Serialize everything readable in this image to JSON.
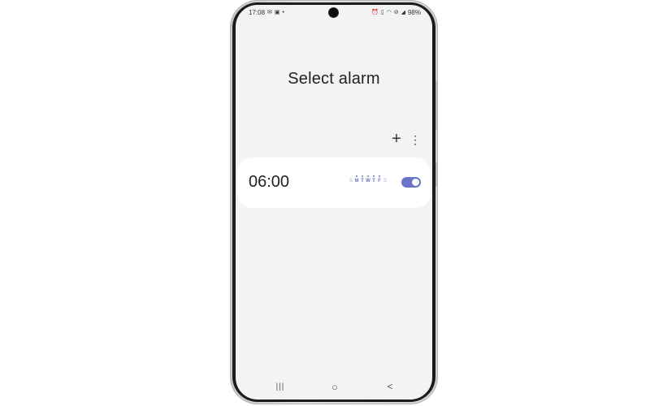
{
  "status_bar": {
    "time": "17:08",
    "battery": "98%",
    "left_icons": [
      "mail-icon",
      "gallery-icon",
      "dot-icon"
    ],
    "right_icons": [
      "alarm-icon",
      "vibrate-icon",
      "wifi-icon",
      "dnd-icon",
      "signal-icon"
    ]
  },
  "page": {
    "title": "Select alarm"
  },
  "toolbar": {
    "add_label": "+",
    "more_label": "⋮"
  },
  "alarm": {
    "time": "06:00",
    "days": [
      {
        "label": "S",
        "active": false
      },
      {
        "label": "M",
        "active": true
      },
      {
        "label": "T",
        "active": true
      },
      {
        "label": "W",
        "active": true
      },
      {
        "label": "T",
        "active": true
      },
      {
        "label": "F",
        "active": true
      },
      {
        "label": "S",
        "active": false
      }
    ],
    "enabled": true
  },
  "nav_bar": {
    "recents": "|||",
    "home": "○",
    "back": "<"
  },
  "colors": {
    "accent": "#6b74c9",
    "screen_bg": "#f3f3f3",
    "card_bg": "#ffffff"
  }
}
